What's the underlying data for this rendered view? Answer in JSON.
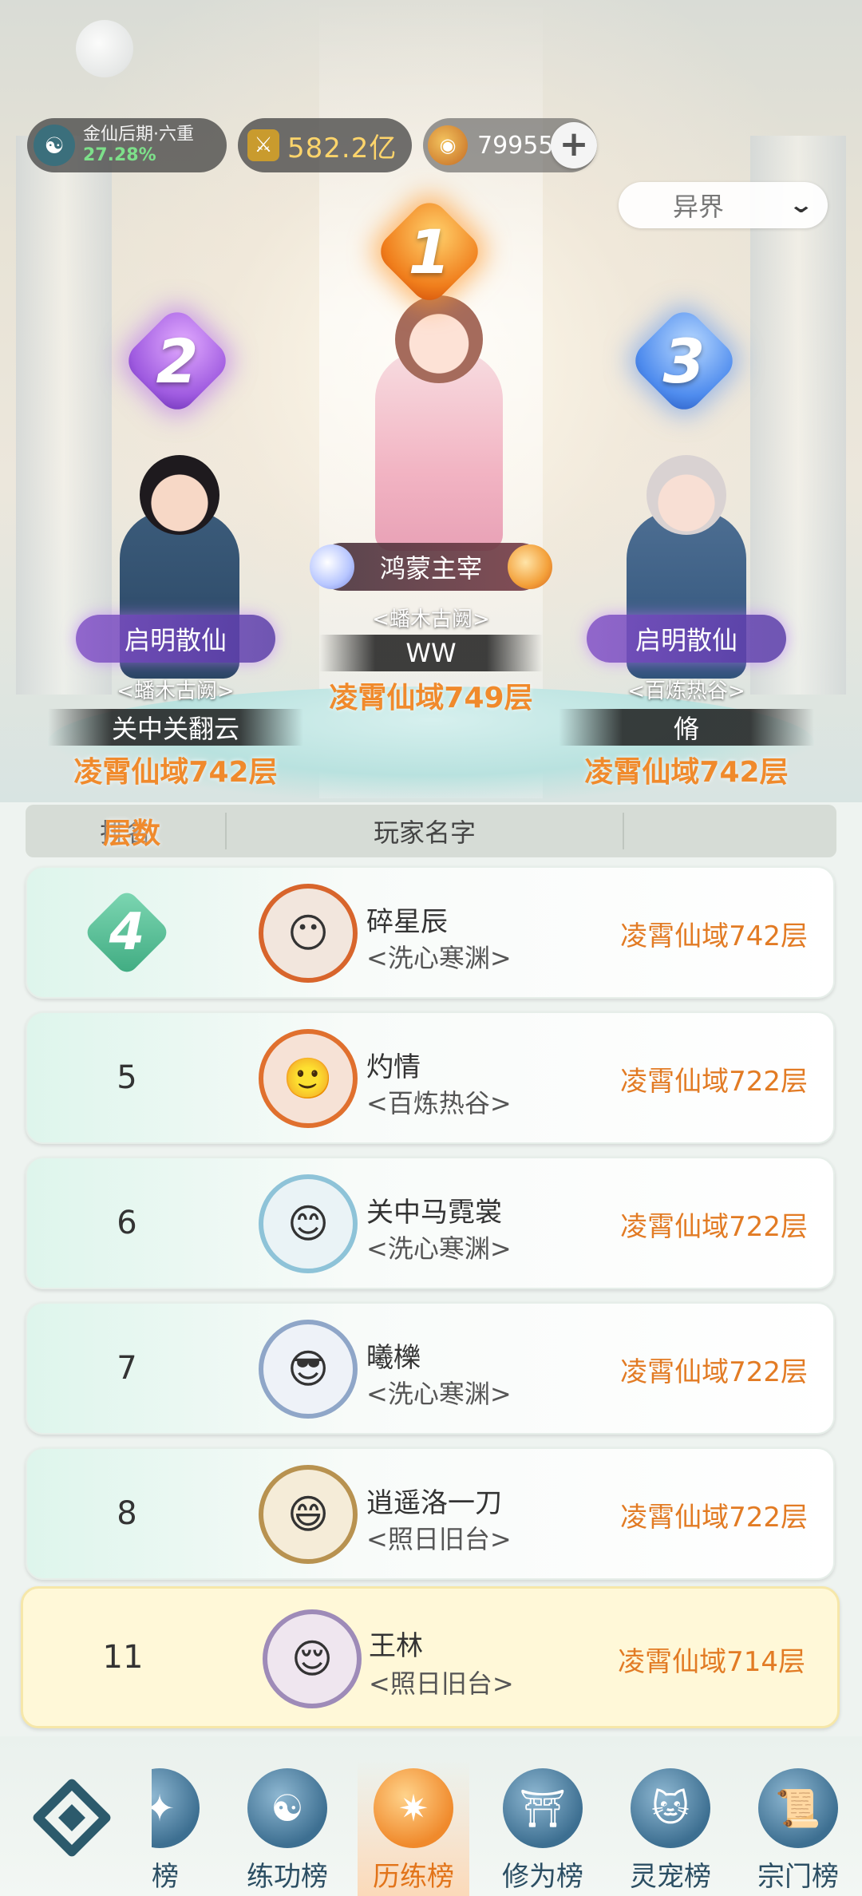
{
  "status": {
    "realm_name": "金仙后期·六重",
    "realm_percent": "27.28%",
    "power": "582.2亿",
    "coins": "79955",
    "plus_label": "+"
  },
  "filter": {
    "selected": "异界",
    "chevron_icon": "chevron-down-icon"
  },
  "podium": [
    {
      "rank": "1",
      "title": "鸿蒙主宰",
      "guild": "<蟠木古阙>",
      "name": "WW",
      "floor": "凌霄仙域749层"
    },
    {
      "rank": "2",
      "title": "启明散仙",
      "guild": "<蟠木古阙>",
      "name": "关中关翻云",
      "floor": "凌霄仙域742层"
    },
    {
      "rank": "3",
      "title": "启明散仙",
      "guild": "<百炼热谷>",
      "name": "脩",
      "floor": "凌霄仙域742层"
    }
  ],
  "table": {
    "headers": {
      "rank": "排名",
      "name": "玩家名字",
      "floor": "层数"
    },
    "rows": [
      {
        "rank": "4",
        "name": "碎星辰",
        "guild": "<洗心寒渊>",
        "floor": "凌霄仙域742层"
      },
      {
        "rank": "5",
        "name": "灼情",
        "guild": "<百炼热谷>",
        "floor": "凌霄仙域722层"
      },
      {
        "rank": "6",
        "name": "关中马霓裳",
        "guild": "<洗心寒渊>",
        "floor": "凌霄仙域722层"
      },
      {
        "rank": "7",
        "name": "曦櫟",
        "guild": "<洗心寒渊>",
        "floor": "凌霄仙域722层"
      },
      {
        "rank": "8",
        "name": "逍遥洛一刀",
        "guild": "<照日旧台>",
        "floor": "凌霄仙域722层"
      }
    ],
    "self": {
      "rank": "11",
      "name": "王林",
      "guild": "<照日旧台>",
      "floor": "凌霄仙域714层"
    }
  },
  "nav": {
    "partial_label": "力榜",
    "items": [
      {
        "label": "练功榜",
        "icon": "yin-yang-icon"
      },
      {
        "label": "历练榜",
        "icon": "star-burst-icon"
      },
      {
        "label": "修为榜",
        "icon": "scholar-hat-icon"
      },
      {
        "label": "灵宠榜",
        "icon": "pet-cat-icon"
      },
      {
        "label": "宗门榜",
        "icon": "scroll-icon"
      }
    ]
  },
  "colors": {
    "accent_orange": "#e27b24",
    "nav_blue": "#2b4e63",
    "self_row": "#fff8d8"
  }
}
